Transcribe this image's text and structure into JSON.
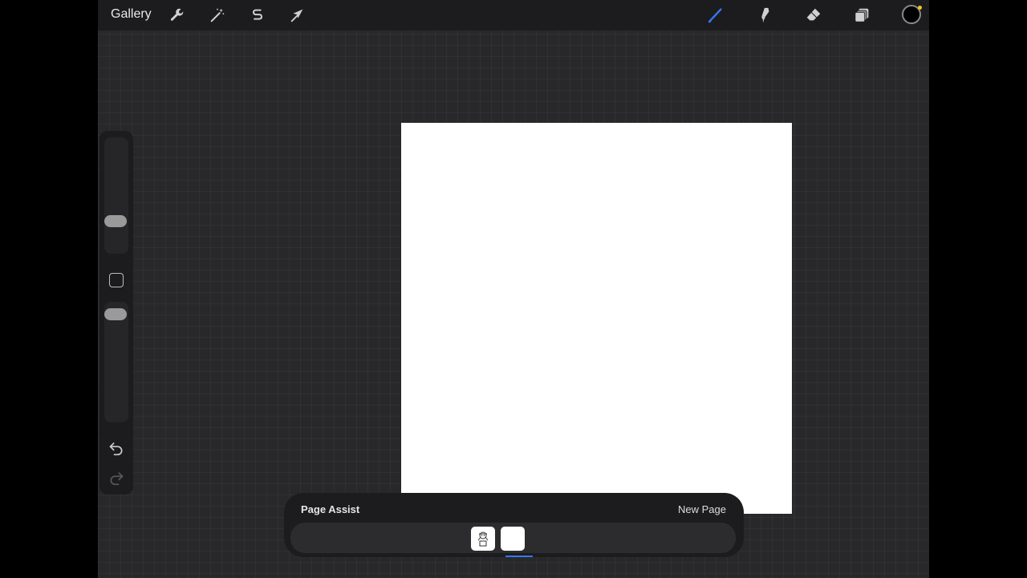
{
  "topbar": {
    "gallery_label": "Gallery",
    "left_tools": [
      "wrench-icon",
      "magic-wand-icon",
      "selection-s-icon",
      "transform-arrow-icon"
    ],
    "right_tools": [
      "brush-icon",
      "smudge-icon",
      "eraser-icon",
      "layers-icon"
    ],
    "active_tool": "brush-icon",
    "active_color": "#000000",
    "accent_color": "#2f7bf5"
  },
  "sidebar": {
    "brush_size_slider": "slider",
    "opacity_slider": "slider",
    "icons": [
      "modify-square-icon",
      "undo-icon",
      "redo-icon"
    ]
  },
  "page_assist": {
    "title": "Page Assist",
    "new_page_label": "New Page",
    "pages_count_visible": 2,
    "selected_page_index": 2
  }
}
